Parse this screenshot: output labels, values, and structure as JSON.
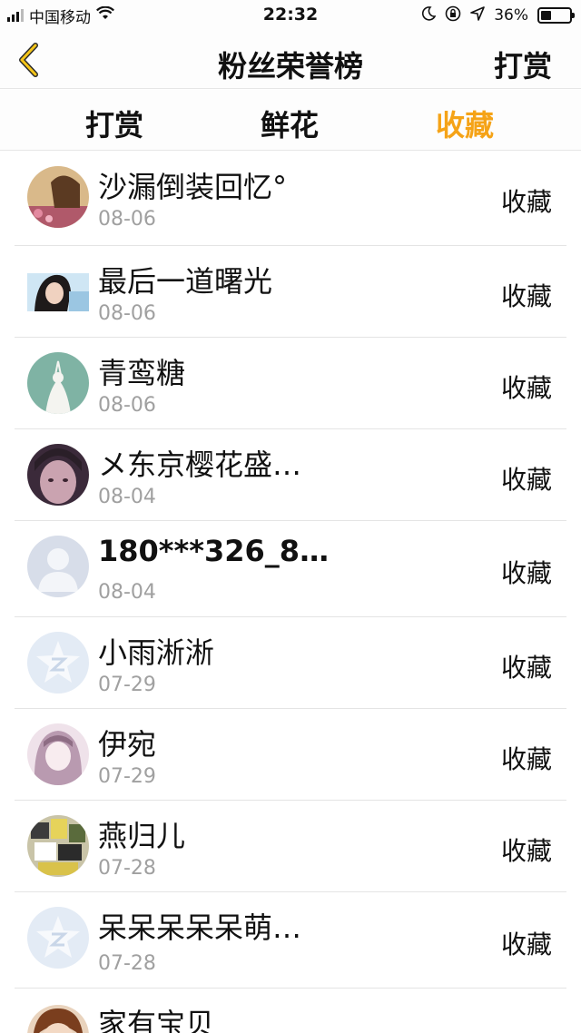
{
  "status_bar": {
    "carrier": "中国移动",
    "time": "22:32",
    "battery_percent": "36%",
    "battery_level": 0.36
  },
  "nav": {
    "title": "粉丝荣誉榜",
    "action_label": "打赏",
    "accent_color": "#f5a317"
  },
  "tabs": [
    {
      "label": "打赏",
      "active": false
    },
    {
      "label": "鲜花",
      "active": false
    },
    {
      "label": "收藏",
      "active": true
    }
  ],
  "fans": [
    {
      "name": "沙漏倒装回忆°",
      "date": "08-06",
      "action": "收藏",
      "avatar": "photo-avatar-girl-field"
    },
    {
      "name": "最后一道曙光",
      "date": "08-06",
      "action": "收藏",
      "avatar": "photo-avatar-girl"
    },
    {
      "name": "青鸾糖",
      "date": "08-06",
      "action": "收藏",
      "avatar": "illustration-avatar-green"
    },
    {
      "name": "メ东京樱花盛…",
      "date": "08-04",
      "action": "收藏",
      "avatar": "photo-avatar-face"
    },
    {
      "name": "180***326_83…",
      "date": "08-04",
      "action": "收藏",
      "avatar": "default-person-avatar"
    },
    {
      "name": "小雨淅淅",
      "date": "07-29",
      "action": "收藏",
      "avatar": "default-qzone-avatar"
    },
    {
      "name": "伊宛",
      "date": "07-29",
      "action": "收藏",
      "avatar": "illustration-avatar-pink"
    },
    {
      "name": "燕归儿",
      "date": "07-28",
      "action": "收藏",
      "avatar": "photo-avatar-collage"
    },
    {
      "name": "呆呆呆呆呆萌…",
      "date": "07-28",
      "action": "收藏",
      "avatar": "default-qzone-avatar"
    },
    {
      "name": "家有宝贝",
      "date": "",
      "action": "收藏",
      "avatar": "photo-avatar-child"
    }
  ]
}
